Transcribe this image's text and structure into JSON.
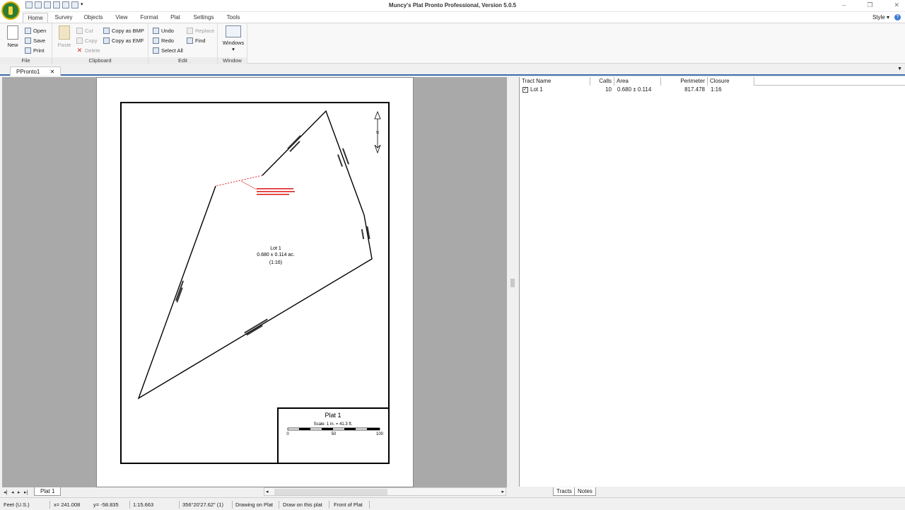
{
  "window": {
    "title": "Muncy's Plat Pronto Professional, Version 5.0.5"
  },
  "ribbon_tabs": [
    "Home",
    "Survey",
    "Objects",
    "View",
    "Format",
    "Plat",
    "Settings",
    "Tools"
  ],
  "style_menu": "Style",
  "help": "?",
  "file_group": {
    "label": "File",
    "new": "New",
    "open": "Open",
    "save": "Save",
    "print": "Print"
  },
  "clipboard_group": {
    "label": "Clipboard",
    "paste": "Paste",
    "cut": "Cut",
    "copy": "Copy",
    "delete": "Delete",
    "copy_bmp": "Copy as BMP",
    "copy_emf": "Copy as EMF"
  },
  "edit_group": {
    "label": "Edit",
    "undo": "Undo",
    "redo": "Redo",
    "select_all": "Select All",
    "replace": "Replace",
    "find": "Find"
  },
  "window_group": {
    "label": "Window",
    "windows": "Windows"
  },
  "document_tab": "PPronto1",
  "plat": {
    "lot_label": "Lot 1",
    "area": "0.680 ± 0.114 ac.",
    "closure": "(1:16)",
    "north": "N",
    "title_block": {
      "title": "Plat 1",
      "scale": "Scale: 1 in. = 41.3 ft."
    },
    "scale_ticks": [
      "0",
      "50",
      "100"
    ]
  },
  "tracts": {
    "columns": [
      "Tract Name",
      "Calls",
      "Area",
      "Perimeter",
      "Closure"
    ],
    "rows": [
      {
        "checked": "✓",
        "name": "Lot 1",
        "calls": "10",
        "area": "0.680 ± 0.114",
        "perimeter": "817.478",
        "closure": "1:16"
      }
    ]
  },
  "sheet_tab": "Plat 1",
  "right_tabs": {
    "tracts": "Tracts",
    "notes": "Notes"
  },
  "status": {
    "units": "Feet (U.S.)",
    "x": "x= 241.008",
    "y": "y= -58.835",
    "scale": "1:15.663",
    "bearing": "356°20'27.62\" (1)",
    "mode": "Drawing on Plat",
    "draw": "Draw on this plat",
    "side": "Front of Plat"
  }
}
